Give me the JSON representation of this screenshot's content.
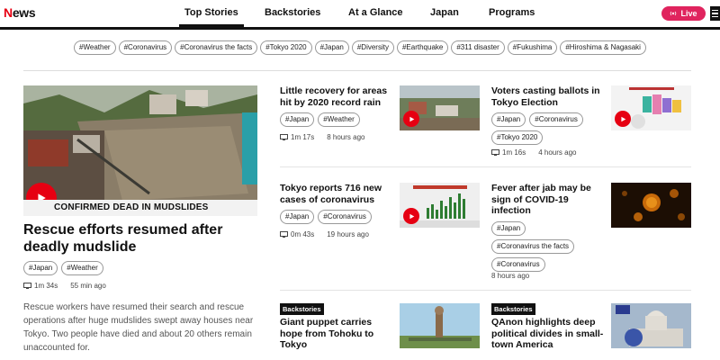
{
  "header": {
    "logo_prefix": "N",
    "logo_rest": "ews",
    "nav": [
      "Top Stories",
      "Backstories",
      "At a Glance",
      "Japan",
      "Programs"
    ],
    "live_label": "Live"
  },
  "tagbar": [
    "#Weather",
    "#Coronavirus",
    "#Coronavirus the facts",
    "#Tokyo 2020",
    "#Japan",
    "#Diversity",
    "#Earthquake",
    "#311 disaster",
    "#Fukushima",
    "#Hiroshima & Nagasaki"
  ],
  "main_story": {
    "image_caption": "CONFIRMED DEAD IN MUDSLIDES",
    "title": "Rescue efforts resumed after deadly mudslide",
    "tags": [
      "#Japan",
      "#Weather"
    ],
    "duration": "1m 34s",
    "time": "55 min ago",
    "description": "Rescue workers have resumed their search and rescue operations after huge mudslides swept away houses near Tokyo. Two people have died and about 20 others remain unaccounted for."
  },
  "cards": [
    {
      "title": "Little recovery for areas hit by 2020 record rain",
      "tags": [
        "#Japan",
        "#Weather"
      ],
      "duration": "1m 17s",
      "time": "8 hours ago"
    },
    {
      "title": "Voters casting ballots in Tokyo Election",
      "tags": [
        "#Japan",
        "#Coronavirus",
        "#Tokyo 2020"
      ],
      "duration": "1m 16s",
      "time": "4 hours ago"
    },
    {
      "title": "Tokyo reports 716 new cases of coronavirus",
      "tags": [
        "#Japan",
        "#Coronavirus"
      ],
      "duration": "0m 43s",
      "time": "19 hours ago"
    },
    {
      "title": "Fever after jab may be sign of COVID-19 infection",
      "tags": [
        "#Japan",
        "#Coronavirus the facts",
        "#Coronavirus"
      ],
      "time": "8 hours ago"
    },
    {
      "badge": "Backstories",
      "title": "Giant puppet carries hope from Tohoku to Tokyo"
    },
    {
      "badge": "Backstories",
      "title": "QAnon highlights deep political divides in small-town America"
    }
  ],
  "colors": {
    "brand_red": "#e60012",
    "live_pink": "#e0245e"
  }
}
